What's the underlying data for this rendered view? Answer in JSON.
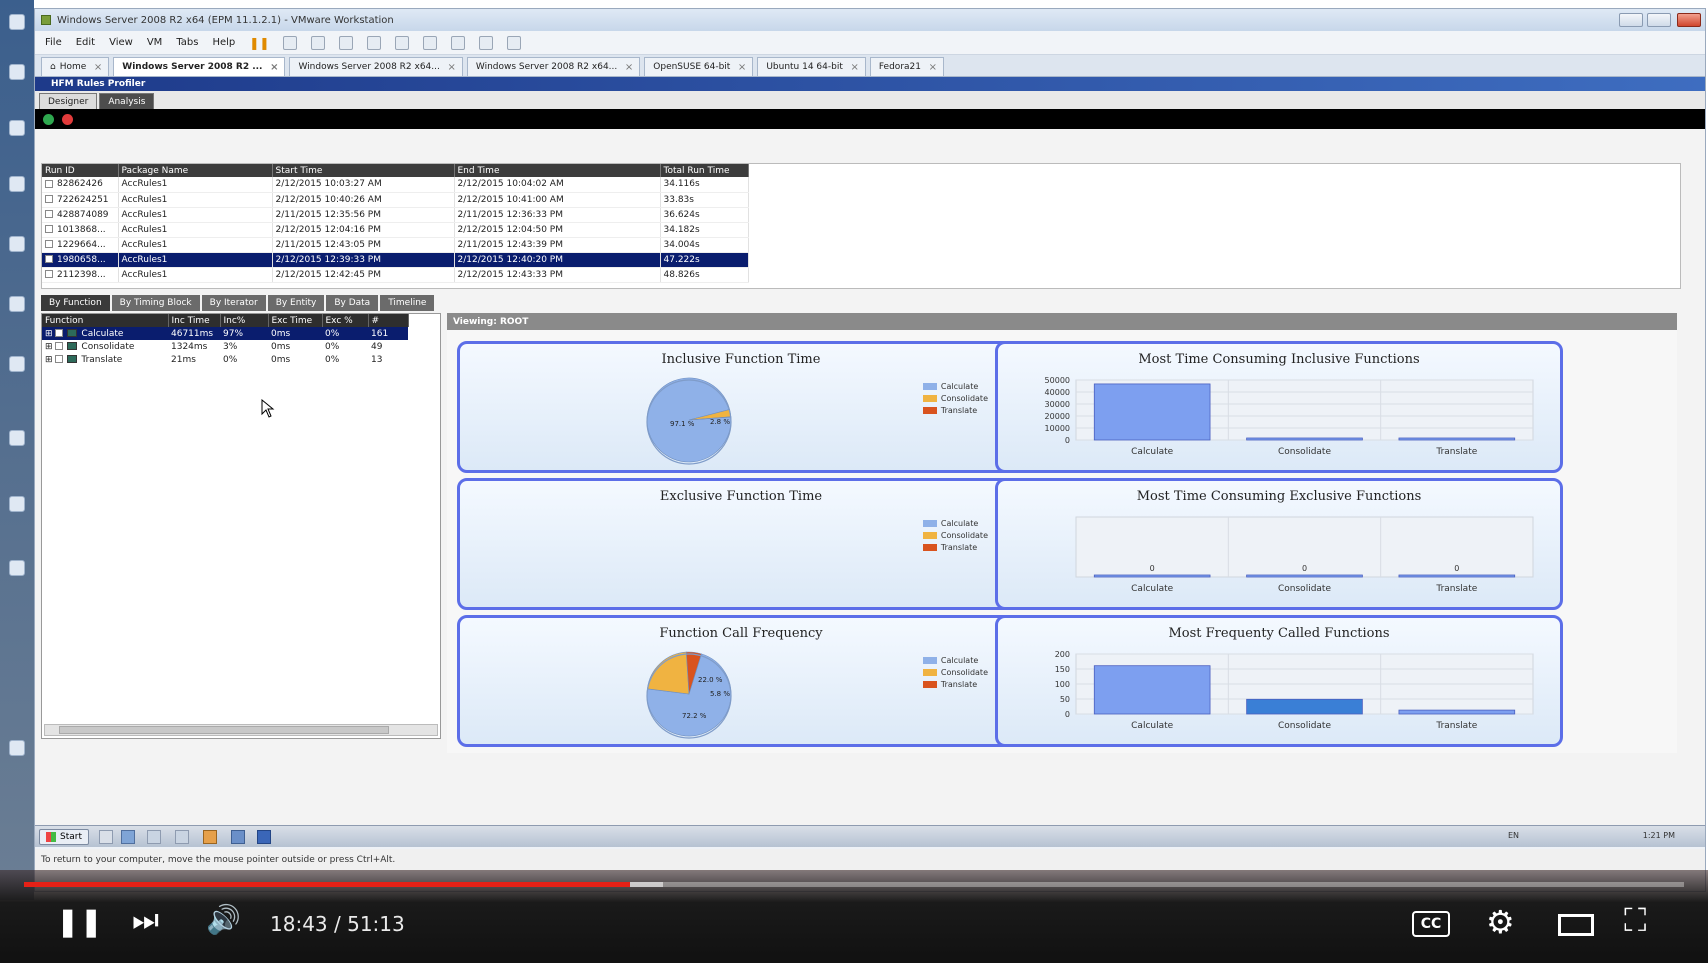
{
  "vm_window": {
    "title": "Windows Server 2008 R2 x64 (EPM 11.1.2.1) - VMware Workstation",
    "menu": [
      "File",
      "Edit",
      "View",
      "VM",
      "Tabs",
      "Help"
    ],
    "tabs": [
      {
        "label": "Home"
      },
      {
        "label": "Windows Server 2008 R2 ..."
      },
      {
        "label": "Windows Server 2008 R2 x64..."
      },
      {
        "label": "Windows Server 2008 R2 x64..."
      },
      {
        "label": "OpenSUSE 64-bit"
      },
      {
        "label": "Ubuntu 14 64-bit"
      },
      {
        "label": "Fedora21"
      }
    ]
  },
  "app": {
    "title": "HFM Rules Profiler",
    "tabs": [
      "Designer",
      "Analysis"
    ],
    "runs": {
      "columns": [
        "Run ID",
        "Package Name",
        "Start Time",
        "End Time",
        "Total Run Time"
      ],
      "rows": [
        [
          "82862426",
          "AccRules1",
          "2/12/2015 10:03:27 AM",
          "2/12/2015 10:04:02 AM",
          "34.116s"
        ],
        [
          "722624251",
          "AccRules1",
          "2/12/2015 10:40:26 AM",
          "2/12/2015 10:41:00 AM",
          "33.83s"
        ],
        [
          "428874089",
          "AccRules1",
          "2/11/2015 12:35:56 PM",
          "2/11/2015 12:36:33 PM",
          "36.624s"
        ],
        [
          "1013868...",
          "AccRules1",
          "2/12/2015 12:04:16 PM",
          "2/12/2015 12:04:50 PM",
          "34.182s"
        ],
        [
          "1229664...",
          "AccRules1",
          "2/11/2015 12:43:05 PM",
          "2/11/2015 12:43:39 PM",
          "34.004s"
        ],
        [
          "1980658...",
          "AccRules1",
          "2/12/2015 12:39:33 PM",
          "2/12/2015 12:40:20 PM",
          "47.222s"
        ],
        [
          "2112398...",
          "AccRules1",
          "2/12/2015 12:42:45 PM",
          "2/12/2015 12:43:33 PM",
          "48.826s"
        ]
      ],
      "selected_index": 5
    },
    "view_tabs": [
      "By Function",
      "By Timing Block",
      "By Iterator",
      "By Entity",
      "By Data",
      "Timeline"
    ],
    "functions": {
      "columns": [
        "Function",
        "Inc Time",
        "Inc%",
        "Exc Time",
        "Exc %",
        "#"
      ],
      "rows": [
        [
          "Calculate",
          "46711ms",
          "97%",
          "0ms",
          "0%",
          "161"
        ],
        [
          "Consolidate",
          "1324ms",
          "3%",
          "0ms",
          "0%",
          "49"
        ],
        [
          "Translate",
          "21ms",
          "0%",
          "0ms",
          "0%",
          "13"
        ]
      ]
    },
    "viewing_label": "Viewing:  ROOT",
    "legend": [
      "Calculate",
      "Consolidate",
      "Translate"
    ],
    "colors": {
      "calculate": "#8fb1e8",
      "consolidate": "#f0b341",
      "translate": "#d9531e",
      "card_border": "#5c6ee8"
    }
  },
  "chart_data": [
    {
      "type": "pie",
      "title": "Inclusive Function Time",
      "labels": [
        "Calculate",
        "Consolidate",
        "Translate"
      ],
      "values": [
        97.1,
        2.8,
        0.1
      ],
      "data_labels": [
        "97.1 %",
        "2.8 %"
      ]
    },
    {
      "type": "bar",
      "title": "Most Time Consuming Inclusive Functions",
      "categories": [
        "Calculate",
        "Consolidate",
        "Translate"
      ],
      "values": [
        46711,
        1324,
        21
      ],
      "ylim": [
        0,
        50000
      ],
      "yticks": [
        "50000",
        "40000",
        "30000",
        "20000",
        "10000",
        "0"
      ]
    },
    {
      "type": "pie",
      "title": "Exclusive Function Time",
      "labels": [
        "Calculate",
        "Consolidate",
        "Translate"
      ],
      "values": [
        0,
        0,
        0
      ]
    },
    {
      "type": "bar",
      "title": "Most Time Consuming Exclusive Functions",
      "categories": [
        "Calculate",
        "Consolidate",
        "Translate"
      ],
      "values": [
        0,
        0,
        0
      ],
      "data_labels": [
        "0",
        "0",
        "0"
      ]
    },
    {
      "type": "pie",
      "title": "Function Call Frequency",
      "labels": [
        "Calculate",
        "Consolidate",
        "Translate"
      ],
      "values": [
        72.2,
        22.0,
        5.8
      ],
      "data_labels": [
        "72.2 %",
        "22.0 %",
        "5.8 %"
      ]
    },
    {
      "type": "bar",
      "title": "Most Frequenty Called Functions",
      "categories": [
        "Calculate",
        "Consolidate",
        "Translate"
      ],
      "values": [
        161,
        49,
        13
      ],
      "ylim": [
        0,
        200
      ],
      "yticks": [
        "200",
        "150",
        "100",
        "50",
        "0"
      ]
    }
  ],
  "guest_taskbar": {
    "start": "Start",
    "lang": "EN",
    "time": "1:21 PM"
  },
  "vm_status": "To return to your computer, move the mouse pointer outside or press Ctrl+Alt.",
  "player": {
    "time": "18:43 / 51:13",
    "progress": 0.365,
    "loaded": 0.385,
    "cc_label": "CC"
  }
}
